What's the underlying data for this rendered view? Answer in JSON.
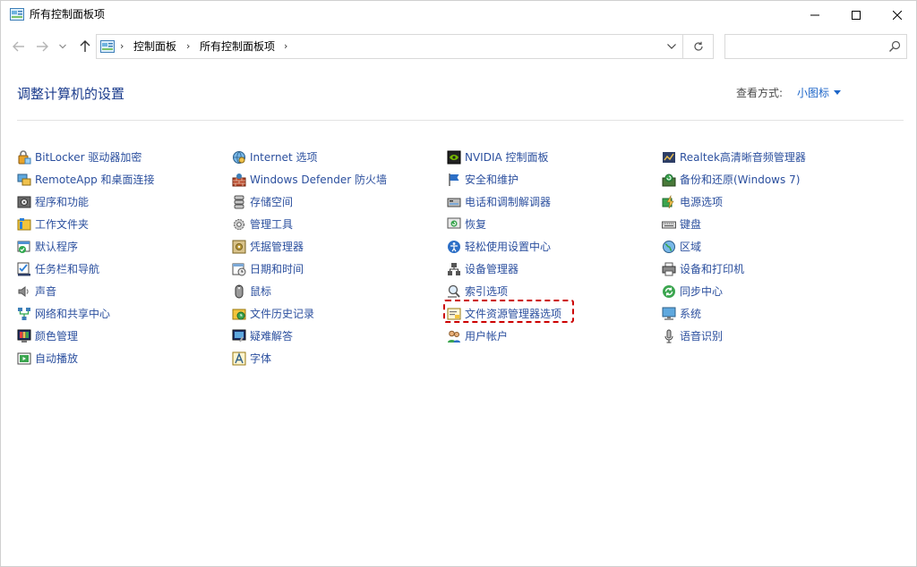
{
  "window": {
    "title": "所有控制面板项",
    "minimize_label": "最小化",
    "maximize_label": "最大化",
    "close_label": "关闭"
  },
  "address": {
    "crumbs": [
      "控制面板",
      "所有控制面板项"
    ],
    "search_placeholder": ""
  },
  "header": {
    "title": "调整计算机的设置",
    "view_by_label": "查看方式:",
    "view_by_value": "小图标"
  },
  "colors": {
    "title_blue": "#1a3b8c",
    "link_blue": "#2b4f9e",
    "accent_blue": "#1e66c8",
    "highlight_red": "#cc0000"
  },
  "columns": [
    [
      {
        "label": "BitLocker 驱动器加密",
        "icon": "bitlocker-icon"
      },
      {
        "label": "RemoteApp 和桌面连接",
        "icon": "remoteapp-icon"
      },
      {
        "label": "程序和功能",
        "icon": "programs-icon"
      },
      {
        "label": "工作文件夹",
        "icon": "work-folders-icon"
      },
      {
        "label": "默认程序",
        "icon": "default-programs-icon"
      },
      {
        "label": "任务栏和导航",
        "icon": "taskbar-icon"
      },
      {
        "label": "声音",
        "icon": "sound-icon"
      },
      {
        "label": "网络和共享中心",
        "icon": "network-icon"
      },
      {
        "label": "颜色管理",
        "icon": "color-management-icon"
      },
      {
        "label": "自动播放",
        "icon": "autoplay-icon"
      }
    ],
    [
      {
        "label": "Internet 选项",
        "icon": "internet-options-icon"
      },
      {
        "label": "Windows Defender 防火墙",
        "icon": "firewall-icon"
      },
      {
        "label": "存储空间",
        "icon": "storage-icon"
      },
      {
        "label": "管理工具",
        "icon": "admin-tools-icon"
      },
      {
        "label": "凭据管理器",
        "icon": "credential-icon"
      },
      {
        "label": "日期和时间",
        "icon": "datetime-icon"
      },
      {
        "label": "鼠标",
        "icon": "mouse-icon"
      },
      {
        "label": "文件历史记录",
        "icon": "file-history-icon"
      },
      {
        "label": "疑难解答",
        "icon": "troubleshoot-icon"
      },
      {
        "label": "字体",
        "icon": "fonts-icon"
      }
    ],
    [
      {
        "label": "NVIDIA 控制面板",
        "icon": "nvidia-icon"
      },
      {
        "label": "安全和维护",
        "icon": "security-flag-icon"
      },
      {
        "label": "电话和调制解调器",
        "icon": "phone-modem-icon"
      },
      {
        "label": "恢复",
        "icon": "recovery-icon"
      },
      {
        "label": "轻松使用设置中心",
        "icon": "ease-of-access-icon"
      },
      {
        "label": "设备管理器",
        "icon": "device-manager-icon"
      },
      {
        "label": "索引选项",
        "icon": "indexing-icon"
      },
      {
        "label": "文件资源管理器选项",
        "icon": "explorer-options-icon"
      },
      {
        "label": "用户帐户",
        "icon": "user-accounts-icon"
      }
    ],
    [
      {
        "label": "Realtek高清晰音频管理器",
        "icon": "realtek-icon"
      },
      {
        "label": "备份和还原(Windows 7)",
        "icon": "backup-icon"
      },
      {
        "label": "电源选项",
        "icon": "power-icon"
      },
      {
        "label": "键盘",
        "icon": "keyboard-icon"
      },
      {
        "label": "区域",
        "icon": "region-icon"
      },
      {
        "label": "设备和打印机",
        "icon": "printer-icon"
      },
      {
        "label": "同步中心",
        "icon": "sync-icon"
      },
      {
        "label": "系统",
        "icon": "system-icon"
      },
      {
        "label": "语音识别",
        "icon": "speech-icon"
      }
    ]
  ]
}
